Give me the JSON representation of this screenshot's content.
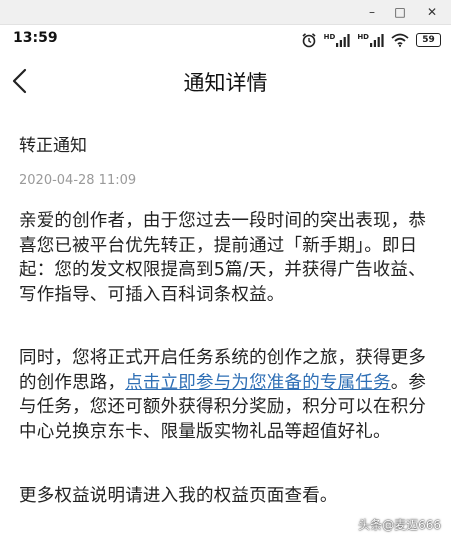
{
  "window": {
    "minimize_glyph": "–",
    "maximize_glyph": "□",
    "close_glyph": "✕"
  },
  "status_bar": {
    "time": "13:59",
    "network_1": "HD",
    "network_2": "HD",
    "battery": "59"
  },
  "header": {
    "title": "通知详情",
    "back_icon": "chevron-left-icon"
  },
  "notice": {
    "title": "转正通知",
    "date": "2020-04-28 11:09",
    "paragraph1": "亲爱的创作者，由于您过去一段时间的突出表现，恭喜您已被平台优先转正，提前通过「新手期」。即日起：您的发文权限提高到5篇/天，并获得广告收益、写作指导、可插入百科词条权益。",
    "paragraph2_before": "同时，您将正式开启任务系统的创作之旅，获得更多的创作思路，",
    "paragraph2_link": "点击立即参与为您准备的专属任务",
    "paragraph2_after": "。参与任务，您还可额外获得积分奖励，积分可以在积分中心兑换京东卡、限量版实物礼品等超值好礼。",
    "paragraph3": "更多权益说明请进入我的权益页面查看。"
  },
  "watermark": {
    "text": "头条@麦迈666"
  },
  "colors": {
    "link": "#2f6fb5",
    "date": "#9a9a9a",
    "text": "#222222"
  }
}
